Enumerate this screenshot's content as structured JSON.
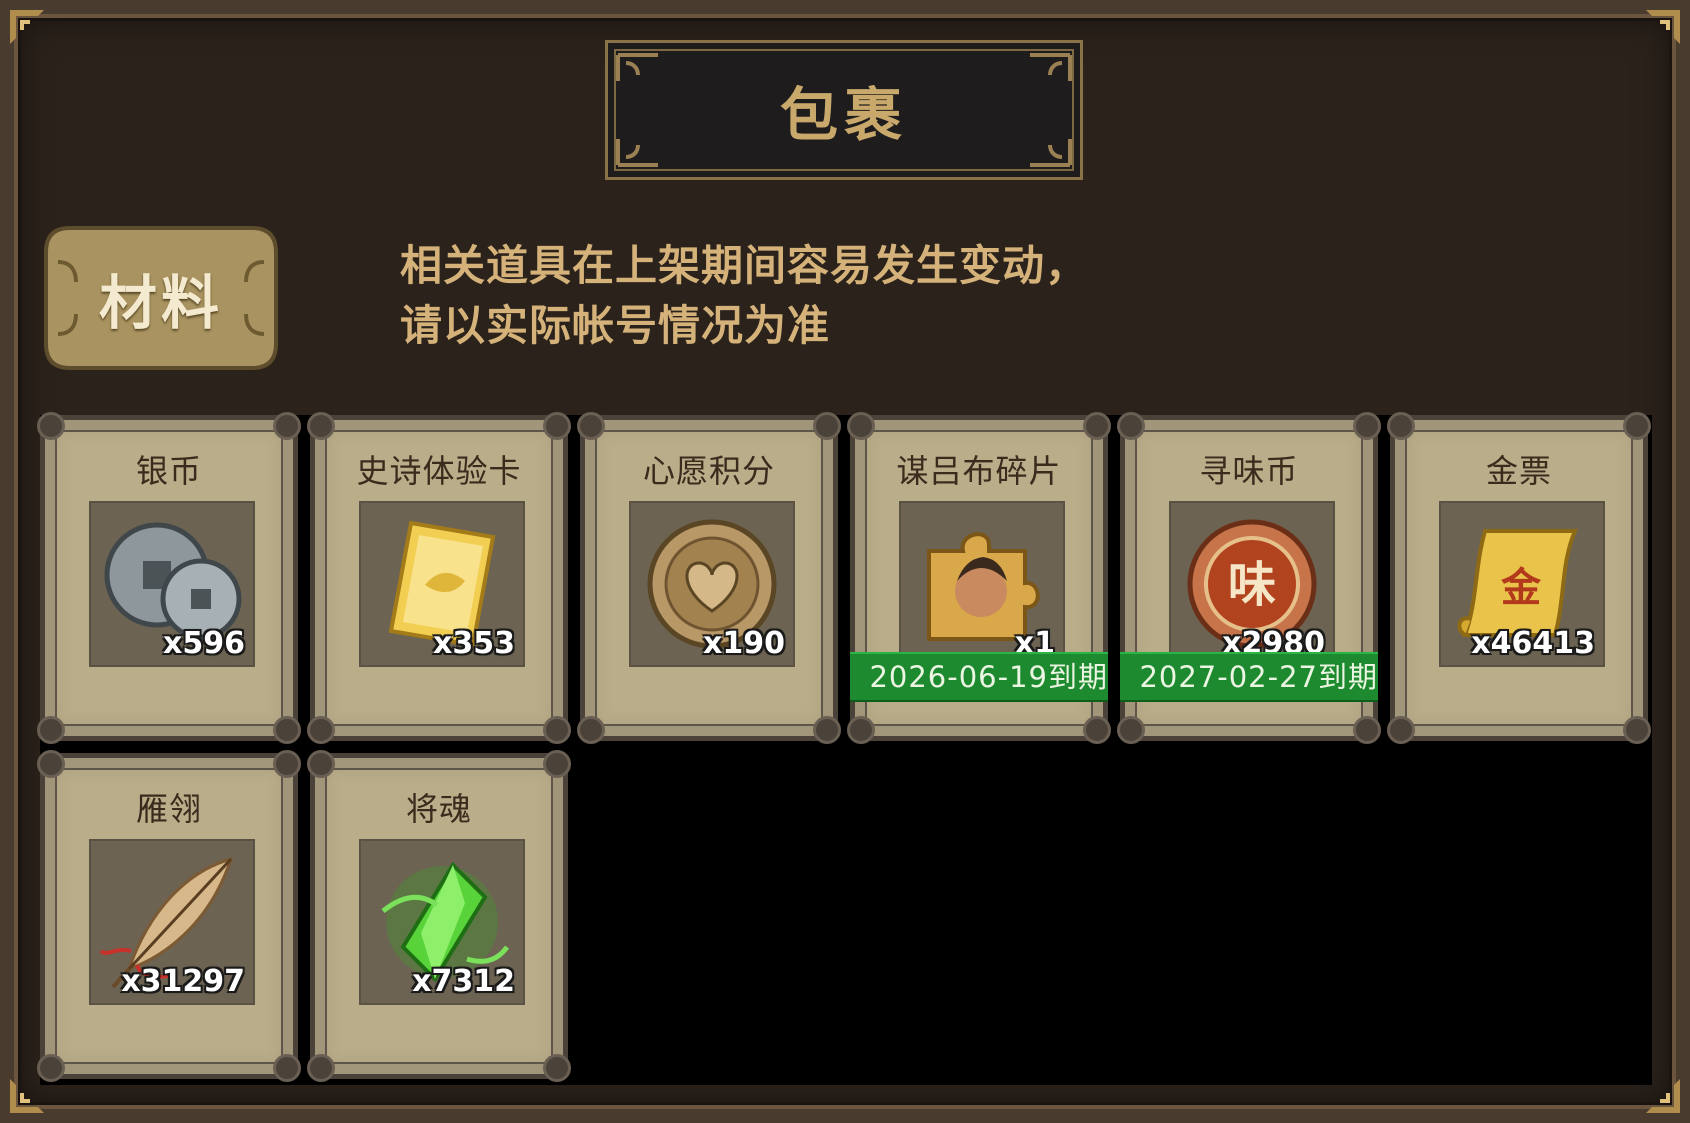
{
  "window": {
    "title": "包裹"
  },
  "tab": {
    "label": "材料"
  },
  "notice": {
    "line1": "相关道具在上架期间容易发生变动，",
    "line2": "请以实际帐号情况为准"
  },
  "items": [
    {
      "name": "银币",
      "count": "x596",
      "icon": "silver-coin-icon",
      "expiry": ""
    },
    {
      "name": "史诗体验卡",
      "count": "x353",
      "icon": "gold-card-icon",
      "expiry": ""
    },
    {
      "name": "心愿积分",
      "count": "x190",
      "icon": "heart-coin-icon",
      "expiry": ""
    },
    {
      "name": "谋吕布碎片",
      "count": "x1",
      "icon": "puzzle-piece-icon",
      "expiry": "2026-06-19到期"
    },
    {
      "name": "寻味币",
      "count": "x2980",
      "icon": "flavor-coin-icon",
      "expiry": "2027-02-27到期"
    },
    {
      "name": "金票",
      "count": "x46413",
      "icon": "gold-scroll-icon",
      "expiry": ""
    },
    {
      "name": "雁翎",
      "count": "x31297",
      "icon": "feather-icon",
      "expiry": ""
    },
    {
      "name": "将魂",
      "count": "x7312",
      "icon": "green-crystal-icon",
      "expiry": ""
    }
  ],
  "colors": {
    "frame": "#2b221b",
    "gold_text": "#c8a86b",
    "card": "#b9ad8a",
    "expiry_bar": "#1d8a2f"
  }
}
